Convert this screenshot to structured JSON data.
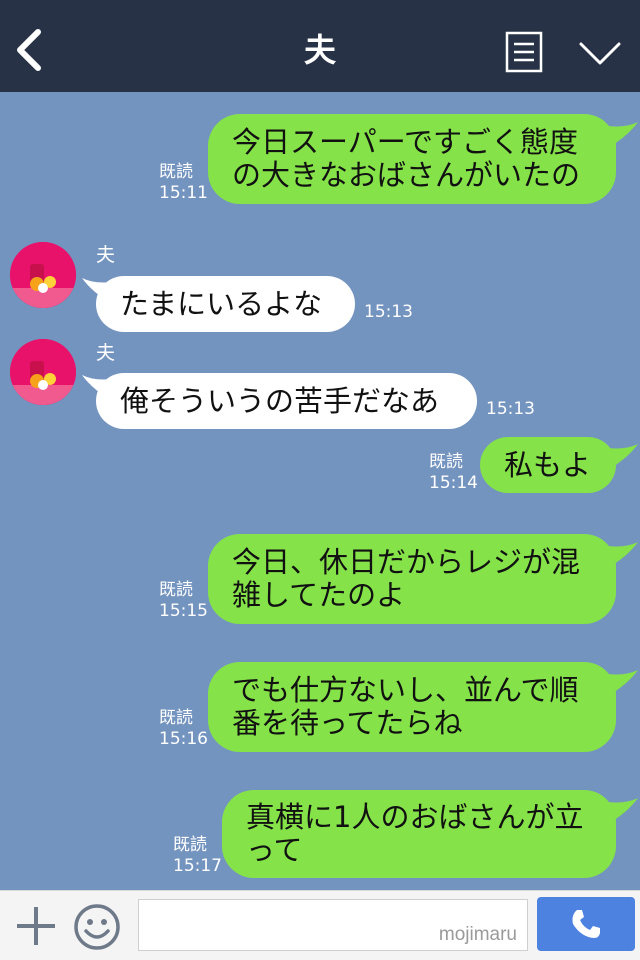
{
  "header": {
    "title": "夫",
    "icons": {
      "back": "chevron-left-icon",
      "menu": "menu-list-icon",
      "collapse": "chevron-down-icon"
    }
  },
  "colors": {
    "header_bg": "#273246",
    "chat_bg": "#7494c0",
    "outgoing_bubble": "#85e249",
    "incoming_bubble": "#ffffff",
    "send_button": "#4d82e0"
  },
  "messages": [
    {
      "direction": "out",
      "lines": [
        "今日スーパーですごく態度",
        "の大きなおばさんがいたの"
      ],
      "read": "既読",
      "time": "15:11"
    },
    {
      "direction": "in",
      "sender": "夫",
      "lines": [
        "たまにいるよな"
      ],
      "time": "15:13"
    },
    {
      "direction": "in",
      "sender": "夫",
      "lines": [
        "俺そういうの苦手だなあ"
      ],
      "time": "15:13"
    },
    {
      "direction": "out",
      "lines": [
        "私もよ"
      ],
      "read": "既読",
      "time": "15:14"
    },
    {
      "direction": "out",
      "lines": [
        "今日、休日だからレジが混",
        "雑してたのよ"
      ],
      "read": "既読",
      "time": "15:15"
    },
    {
      "direction": "out",
      "lines": [
        "でも仕方ないし、並んで順",
        "番を待ってたらね"
      ],
      "read": "既読",
      "time": "15:16"
    },
    {
      "direction": "out",
      "lines": [
        "真横に1人のおばさんが立",
        "って"
      ],
      "read": "既読",
      "time": "15:17"
    }
  ],
  "footer": {
    "input_value": "",
    "watermark": "mojimaru",
    "icons": {
      "add": "plus-icon",
      "emoji": "smiley-icon",
      "call": "phone-icon"
    }
  }
}
